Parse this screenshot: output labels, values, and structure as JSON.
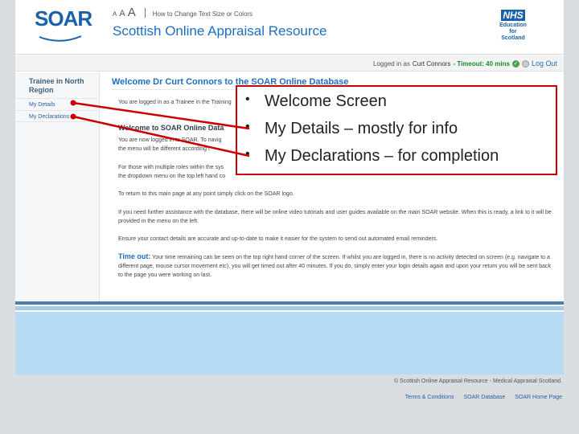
{
  "header": {
    "logo_text": "SOAR",
    "text_size_glyphs": [
      "A",
      "A",
      "A"
    ],
    "text_size_link": "How to Change Text Size or Colors",
    "site_title": "Scottish Online Appraisal Resource",
    "nhs_mark": "NHS",
    "nhs_sub": [
      "Education",
      "for",
      "Scotland"
    ]
  },
  "login_bar": {
    "logged_in_label": "Logged in as",
    "user_name": "Curt Connors",
    "timeout_text": "- Timeout: 40 mins",
    "logout_label": "Log Out"
  },
  "sidebar": {
    "heading": "Trainee in North Region",
    "items": [
      {
        "label": "My Details"
      },
      {
        "label": "My Declarations"
      }
    ]
  },
  "main": {
    "welcome_title": "Welcome Dr  Curt Connors  to the SOAR Online Database",
    "paragraphs": {
      "role": "You are logged in as a Trainee in the Training",
      "sub_title": "Welcome to SOAR Online Data",
      "navigate": "You are now logged in to SOAR. To navig",
      "navigate2": "the menu will be different according t",
      "roles": "For those with multiple roles within the sys",
      "roles2": "the dropdown menu on the top left hand co",
      "return": "To return to this main page at any point simply click on the SOAR logo.",
      "help": "If you need further assistance with the database, there will be online video tutorials and user guides available on the main SOAR website. When this is ready, a link to it will be provided in the menu on the left.",
      "contact": "Ensure your contact details are accurate and up-to-date to make it easier for the system to send out automated email reminders.",
      "timeout_heading": "Time out:",
      "timeout_text": "Your time remaining can be seen on the top right hand corner of the screen. If whilst you are logged in, there is no activity detected on screen (e.g. navigate to a different page, mouse cursor movement etc), you will get timed out after 40 minutes. If you do, simply enter your login details again and upon your return you will be sent back to the page you were working on last."
    }
  },
  "callout": {
    "bullets": [
      "Welcome Screen",
      "My Details – mostly for info",
      "My Declarations – for completion"
    ]
  },
  "footer": {
    "copyright": "© Scottish Online Appraisal Resource - Medical Appraisal Scotland.",
    "links": [
      "Terms & Conditions",
      "SOAR Database",
      "SOAR Home Page"
    ]
  },
  "colors": {
    "brand_blue": "#1e6fbf",
    "callout_red": "#cc0000",
    "band_blue": "#b6dcf3"
  }
}
